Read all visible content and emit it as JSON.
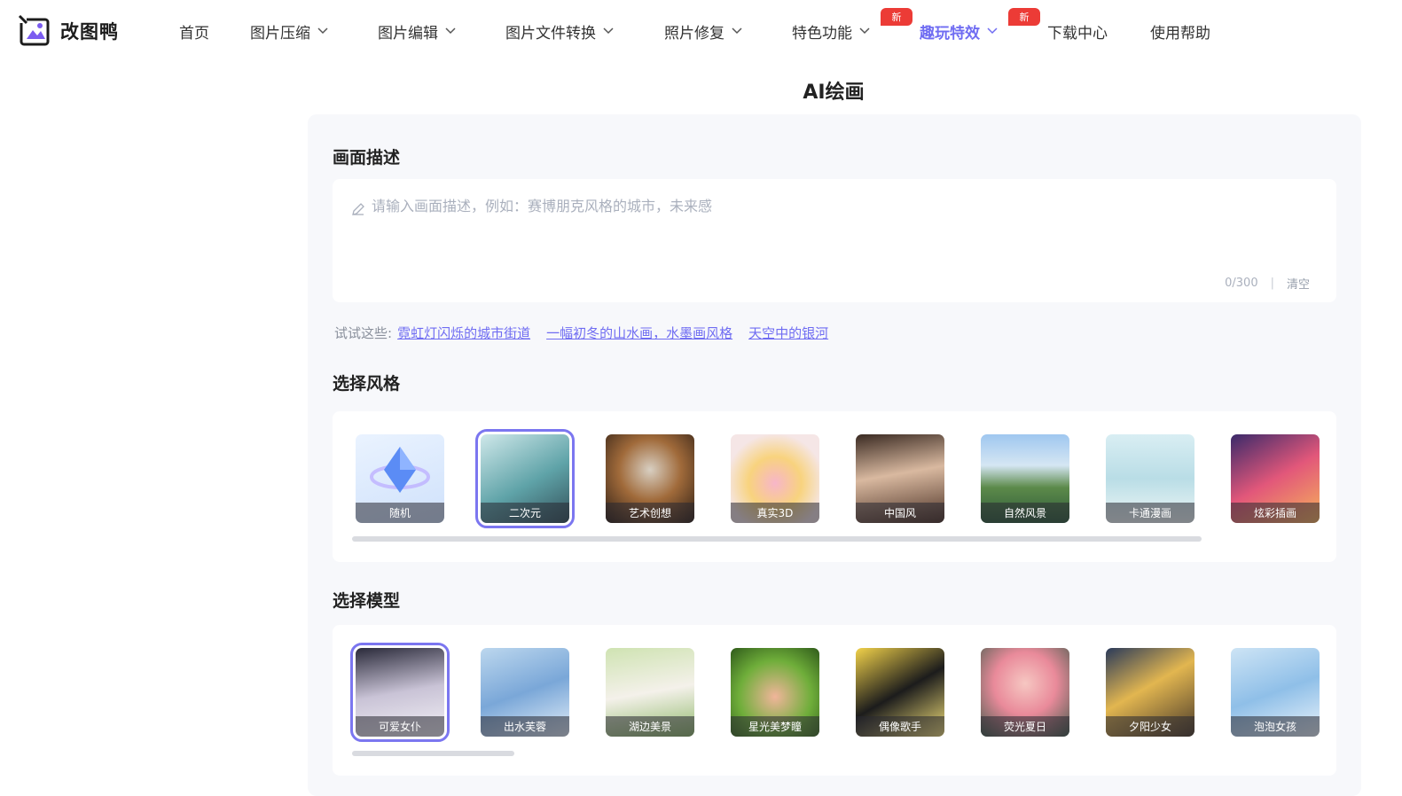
{
  "brand": {
    "name": "改图鸭",
    "accent": "#6f6cf2",
    "badge_color": "#ec3b36"
  },
  "nav": {
    "items": [
      {
        "label": "首页",
        "dropdown": false
      },
      {
        "label": "图片压缩",
        "dropdown": true
      },
      {
        "label": "图片编辑",
        "dropdown": true
      },
      {
        "label": "图片文件转换",
        "dropdown": true
      },
      {
        "label": "照片修复",
        "dropdown": true
      },
      {
        "label": "特色功能",
        "dropdown": true,
        "badge": "新"
      },
      {
        "label": "趣玩特效",
        "dropdown": true,
        "badge": "新",
        "active": true
      },
      {
        "label": "下载中心",
        "dropdown": false
      },
      {
        "label": "使用帮助",
        "dropdown": false
      }
    ]
  },
  "page": {
    "title": "AI绘画"
  },
  "prompt": {
    "section_title": "画面描述",
    "placeholder": "请输入画面描述，例如：赛博朋克风格的城市，未来感",
    "value": "",
    "counter": "0/300",
    "separator": "|",
    "clear_label": "清空"
  },
  "suggestions": {
    "label": "试试这些:",
    "items": [
      "霓虹灯闪烁的城市街道",
      "一幅初冬的山水画，水墨画风格",
      "天空中的银河"
    ]
  },
  "styles": {
    "section_title": "选择风格",
    "items": [
      {
        "label": "随机",
        "icon": "diamond-icon"
      },
      {
        "label": "二次元",
        "selected": true
      },
      {
        "label": "艺术创想"
      },
      {
        "label": "真实3D"
      },
      {
        "label": "中国风"
      },
      {
        "label": "自然风景"
      },
      {
        "label": "卡通漫画"
      },
      {
        "label": "炫彩插画"
      }
    ]
  },
  "models": {
    "section_title": "选择模型",
    "items": [
      {
        "label": "可爱女仆",
        "selected": true
      },
      {
        "label": "出水芙蓉"
      },
      {
        "label": "湖边美景"
      },
      {
        "label": "星光美梦瞳"
      },
      {
        "label": "偶像歌手"
      },
      {
        "label": "荧光夏日"
      },
      {
        "label": "夕阳少女"
      },
      {
        "label": "泡泡女孩"
      }
    ]
  }
}
